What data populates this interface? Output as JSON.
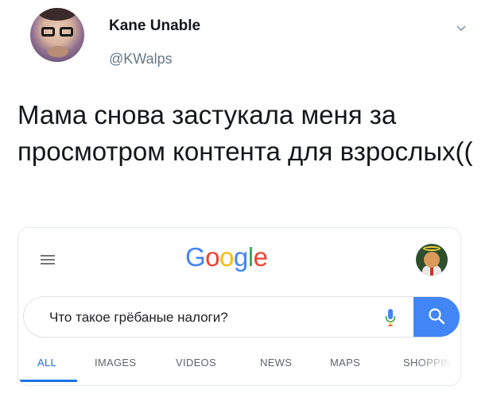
{
  "tweet": {
    "display_name": "Kane Unable",
    "username": "@KWalps",
    "text": "Мама снова застукала меня за просмотром контента для взрослых(("
  },
  "google": {
    "logo_letters": [
      {
        "char": "G",
        "color": "#4285f4"
      },
      {
        "char": "o",
        "color": "#ea4335"
      },
      {
        "char": "o",
        "color": "#fbbc05"
      },
      {
        "char": "g",
        "color": "#4285f4"
      },
      {
        "char": "l",
        "color": "#34a853"
      },
      {
        "char": "e",
        "color": "#ea4335"
      }
    ],
    "search_value": "Что такое грёбаные налоги?",
    "tabs": [
      {
        "label": "ALL",
        "active": true
      },
      {
        "label": "IMAGES",
        "active": false
      },
      {
        "label": "VIDEOS",
        "active": false
      },
      {
        "label": "NEWS",
        "active": false
      },
      {
        "label": "MAPS",
        "active": false
      },
      {
        "label": "SHOPPIN",
        "active": false
      }
    ],
    "icons": {
      "menu": "hamburger-menu-icon",
      "mic": "microphone-icon",
      "search": "magnifier-icon"
    },
    "colors": {
      "accent": "#1a73e8",
      "search_button": "#4285f4"
    }
  }
}
